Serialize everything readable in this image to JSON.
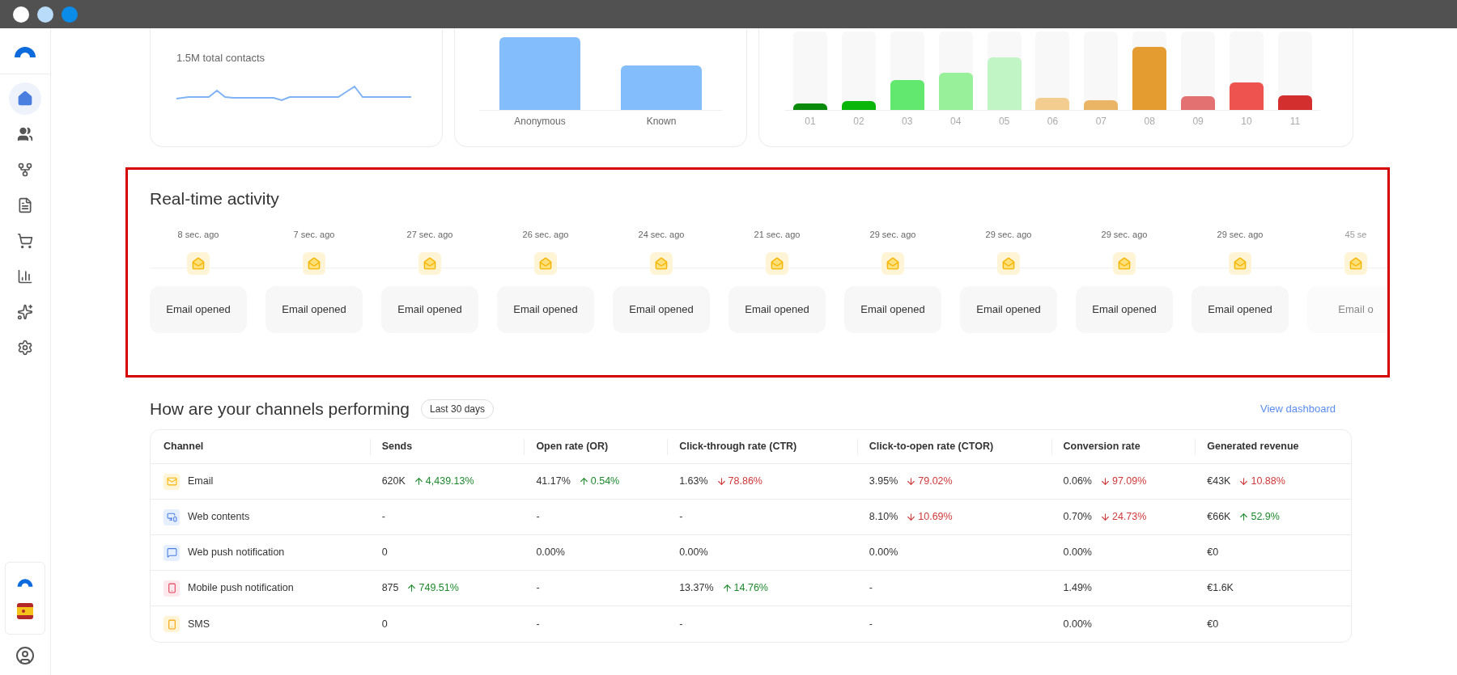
{
  "sidebar": {
    "items": [
      {
        "kind": "home",
        "selected": true
      },
      {
        "kind": "users",
        "selected": false
      },
      {
        "kind": "branch",
        "selected": false
      },
      {
        "kind": "document",
        "selected": false
      },
      {
        "kind": "cart",
        "selected": false
      },
      {
        "kind": "chart",
        "selected": false
      },
      {
        "kind": "sparkles",
        "selected": false
      },
      {
        "kind": "settings",
        "selected": false
      }
    ]
  },
  "cards": [
    {
      "kind": "contacts",
      "caption": "1.5M total contacts"
    },
    {
      "kind": "bars",
      "labels": [
        "Anonymous",
        "Known"
      ]
    },
    {
      "kind": "colorbars",
      "labels": [
        "01",
        "02",
        "03",
        "04",
        "05",
        "06",
        "07",
        "08",
        "09",
        "10",
        "11"
      ]
    }
  ],
  "activity": {
    "title": "Real-time activity",
    "events": [
      {
        "time": "8 sec. ago",
        "label": "Email opened",
        "faded": false
      },
      {
        "time": "7 sec. ago",
        "label": "Email opened",
        "faded": false
      },
      {
        "time": "27 sec. ago",
        "label": "Email opened",
        "faded": false
      },
      {
        "time": "26 sec. ago",
        "label": "Email opened",
        "faded": false
      },
      {
        "time": "24 sec. ago",
        "label": "Email opened",
        "faded": false
      },
      {
        "time": "21 sec. ago",
        "label": "Email opened",
        "faded": false
      },
      {
        "time": "29 sec. ago",
        "label": "Email opened",
        "faded": false
      },
      {
        "time": "29 sec. ago",
        "label": "Email opened",
        "faded": false
      },
      {
        "time": "29 sec. ago",
        "label": "Email opened",
        "faded": false
      },
      {
        "time": "29 sec. ago",
        "label": "Email opened",
        "faded": false
      },
      {
        "time": "45 se",
        "label": "Email o",
        "faded": true
      }
    ]
  },
  "channels": {
    "title": "How are your channels performing",
    "period": "Last 30 days",
    "link": "View dashboard",
    "columns": [
      "Channel",
      "Sends",
      "Open rate (OR)",
      "Click-through rate (CTR)",
      "Click-to-open rate (CTOR)",
      "Conversion rate",
      "Generated revenue"
    ],
    "rows": [
      {
        "kind": "email",
        "cells": [
          {
            "value": "Email"
          },
          {
            "value": "620K",
            "change": "4,439.13%",
            "kind": "up"
          },
          {
            "value": "41.17%",
            "change": "0.54%",
            "kind": "up"
          },
          {
            "value": "1.63%",
            "change": "78.86%",
            "kind": "down"
          },
          {
            "value": "3.95%",
            "change": "79.02%",
            "kind": "down"
          },
          {
            "value": "0.06%",
            "change": "97.09%",
            "kind": "down"
          },
          {
            "value": "€43K",
            "change": "10.88%",
            "kind": "down"
          }
        ]
      },
      {
        "kind": "web",
        "cells": [
          {
            "value": "Web contents"
          },
          {
            "value": "-"
          },
          {
            "value": "-"
          },
          {
            "value": "-"
          },
          {
            "value": "8.10%",
            "change": "10.69%",
            "kind": "down"
          },
          {
            "value": "0.70%",
            "change": "24.73%",
            "kind": "down"
          },
          {
            "value": "€66K",
            "change": "52.9%",
            "kind": "up"
          }
        ]
      },
      {
        "kind": "webpush",
        "cells": [
          {
            "value": "Web push notification"
          },
          {
            "value": "0"
          },
          {
            "value": "0.00%"
          },
          {
            "value": "0.00%"
          },
          {
            "value": "0.00%"
          },
          {
            "value": "0.00%"
          },
          {
            "value": "€0"
          }
        ]
      },
      {
        "kind": "mobilepush",
        "cells": [
          {
            "value": "Mobile push notification"
          },
          {
            "value": "875",
            "change": "749.51%",
            "kind": "up"
          },
          {
            "value": "-"
          },
          {
            "value": "13.37%",
            "change": "14.76%",
            "kind": "up"
          },
          {
            "value": "-"
          },
          {
            "value": "1.49%"
          },
          {
            "value": "€1.6K"
          }
        ]
      },
      {
        "kind": "sms",
        "cells": [
          {
            "value": "SMS"
          },
          {
            "value": "0"
          },
          {
            "value": "-"
          },
          {
            "value": "-"
          },
          {
            "value": "-"
          },
          {
            "value": "0.00%"
          },
          {
            "value": "€0"
          }
        ]
      }
    ]
  }
}
